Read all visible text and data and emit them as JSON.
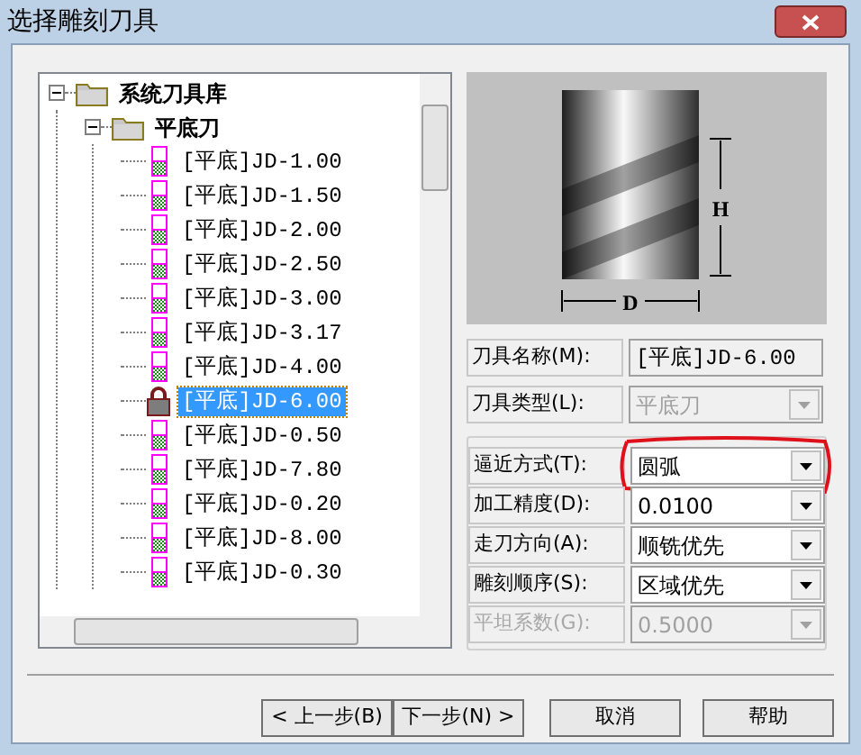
{
  "window": {
    "title": "选择雕刻刀具"
  },
  "tree": [
    {
      "label": "系统刀具库",
      "kind": "folder",
      "expanded": true,
      "selected": false,
      "children": [
        {
          "label": "平底刀",
          "kind": "folder",
          "expanded": true,
          "selected": false,
          "children": [
            {
              "label": "[平底]JD-1.00",
              "kind": "tool",
              "selected": false
            },
            {
              "label": "[平底]JD-1.50",
              "kind": "tool",
              "selected": false
            },
            {
              "label": "[平底]JD-2.00",
              "kind": "tool",
              "selected": false
            },
            {
              "label": "[平底]JD-2.50",
              "kind": "tool",
              "selected": false
            },
            {
              "label": "[平底]JD-3.00",
              "kind": "tool",
              "selected": false
            },
            {
              "label": "[平底]JD-3.17",
              "kind": "tool",
              "selected": false
            },
            {
              "label": "[平底]JD-4.00",
              "kind": "tool",
              "selected": false
            },
            {
              "label": "[平底]JD-6.00",
              "kind": "locked",
              "selected": true
            },
            {
              "label": "[平底]JD-0.50",
              "kind": "tool",
              "selected": false
            },
            {
              "label": "[平底]JD-7.80",
              "kind": "tool",
              "selected": false
            },
            {
              "label": "[平底]JD-0.20",
              "kind": "tool",
              "selected": false
            },
            {
              "label": "[平底]JD-8.00",
              "kind": "tool",
              "selected": false
            },
            {
              "label": "[平底]JD-0.30",
              "kind": "tool",
              "selected": false
            }
          ]
        }
      ]
    }
  ],
  "preview": {
    "height_label": "H",
    "diameter_label": "D"
  },
  "fields": [
    {
      "label": "刀具名称(M):",
      "kind": "text",
      "value": "[平底]JD-6.00",
      "disabled": false
    },
    {
      "label": "刀具类型(L):",
      "kind": "combo",
      "value": "平底刀",
      "disabled": true
    }
  ],
  "options": [
    {
      "label": "逼近方式(T):",
      "value": "圆弧",
      "disabled": false,
      "highlighted": true
    },
    {
      "label": "加工精度(D):",
      "value": "0.0100",
      "disabled": false,
      "highlighted": false
    },
    {
      "label": "走刀方向(A):",
      "value": "顺铣优先",
      "disabled": false,
      "highlighted": false
    },
    {
      "label": "雕刻顺序(S):",
      "value": "区域优先",
      "disabled": false,
      "highlighted": false
    },
    {
      "label": "平坦系数(G):",
      "value": "0.5000",
      "disabled": true,
      "highlighted": false
    }
  ],
  "buttons": [
    {
      "label": "< 上一步(B)"
    },
    {
      "label": "下一步(N) >"
    },
    {
      "label": "取消"
    },
    {
      "label": "帮助"
    }
  ]
}
